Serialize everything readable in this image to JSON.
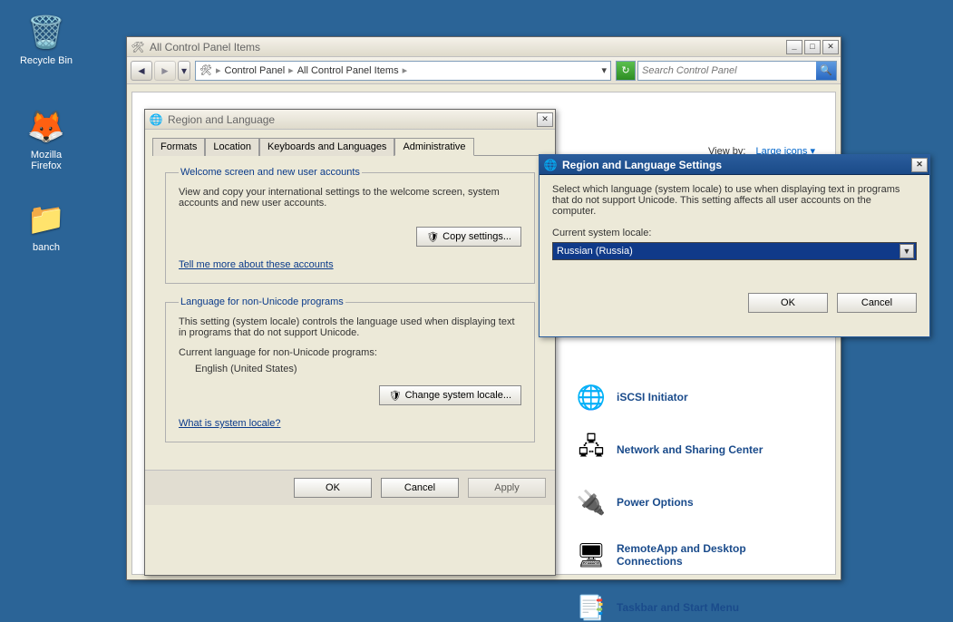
{
  "desktop": {
    "recycle_bin": "Recycle Bin",
    "firefox": "Mozilla Firefox",
    "folder": "banch"
  },
  "controlPanel": {
    "title": "All Control Panel Items",
    "breadcrumb": {
      "a": "Control Panel",
      "b": "All Control Panel Items"
    },
    "search_placeholder": "Search Control Panel",
    "viewby_label": "View by:",
    "viewby_value": "Large icons",
    "items": [
      {
        "label": "iSCSI Initiator",
        "icon": "🌐"
      },
      {
        "label": "Network and Sharing Center",
        "icon": "🖧"
      },
      {
        "label": "Power Options",
        "icon": "🔌"
      },
      {
        "label": "RemoteApp and Desktop Connections",
        "icon": "🖥"
      },
      {
        "label": "Taskbar and Start Menu",
        "icon": "📑"
      }
    ]
  },
  "region": {
    "title": "Region and Language",
    "tabs": {
      "formats": "Formats",
      "location": "Location",
      "keyboards": "Keyboards and Languages",
      "admin": "Administrative"
    },
    "welcome": {
      "legend": "Welcome screen and new user accounts",
      "text": "View and copy your international settings to the welcome screen, system accounts and new user accounts.",
      "copy_btn": "Copy settings...",
      "more_link": "Tell me more about these accounts"
    },
    "nonunicode": {
      "legend": "Language for non-Unicode programs",
      "text": "This setting (system locale) controls the language used when displaying text in programs that do not support Unicode.",
      "label": "Current language for non-Unicode programs:",
      "value": "English (United States)",
      "change_btn": "Change system locale...",
      "what_link": "What is system locale?"
    },
    "ok": "OK",
    "cancel": "Cancel",
    "apply": "Apply"
  },
  "locale": {
    "title": "Region and Language Settings",
    "text": "Select which language (system locale) to use when displaying text in programs that do not support Unicode. This setting affects all user accounts on the computer.",
    "label": "Current system locale:",
    "value": "Russian (Russia)",
    "ok": "OK",
    "cancel": "Cancel"
  }
}
